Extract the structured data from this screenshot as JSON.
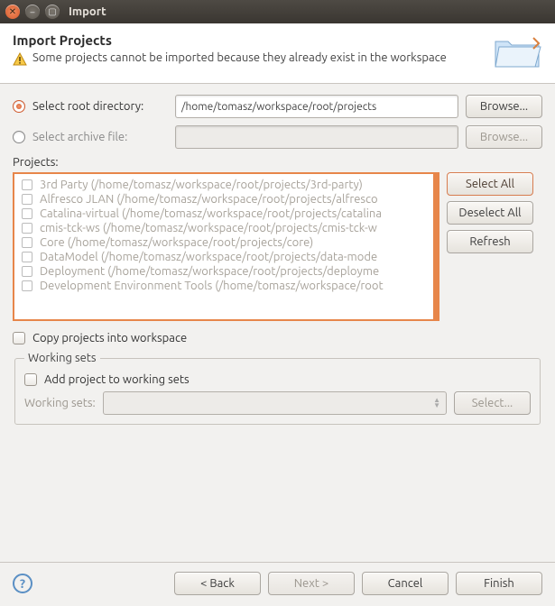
{
  "window_title": "Import",
  "header": {
    "title": "Import Projects",
    "warning": "Some projects cannot be imported because they already exist in the workspace"
  },
  "root_dir": {
    "label": "Select root directory:",
    "value": "/home/tomasz/workspace/root/projects",
    "browse": "Browse..."
  },
  "archive": {
    "label": "Select archive file:",
    "value": "",
    "browse": "Browse..."
  },
  "projects_label": "Projects:",
  "projects": [
    "3rd Party (/home/tomasz/workspace/root/projects/3rd-party)",
    "Alfresco JLAN (/home/tomasz/workspace/root/projects/alfresco",
    "Catalina-virtual (/home/tomasz/workspace/root/projects/catalina",
    "cmis-tck-ws (/home/tomasz/workspace/root/projects/cmis-tck-w",
    "Core (/home/tomasz/workspace/root/projects/core)",
    "DataModel (/home/tomasz/workspace/root/projects/data-mode",
    "Deployment (/home/tomasz/workspace/root/projects/deployme",
    "Development Environment Tools (/home/tomasz/workspace/root"
  ],
  "side": {
    "select_all": "Select All",
    "deselect_all": "Deselect All",
    "refresh": "Refresh"
  },
  "copy_label": "Copy projects into workspace",
  "ws": {
    "legend": "Working sets",
    "add": "Add project to working sets",
    "label": "Working sets:",
    "select": "Select..."
  },
  "footer": {
    "back": "< Back",
    "next": "Next >",
    "cancel": "Cancel",
    "finish": "Finish"
  }
}
